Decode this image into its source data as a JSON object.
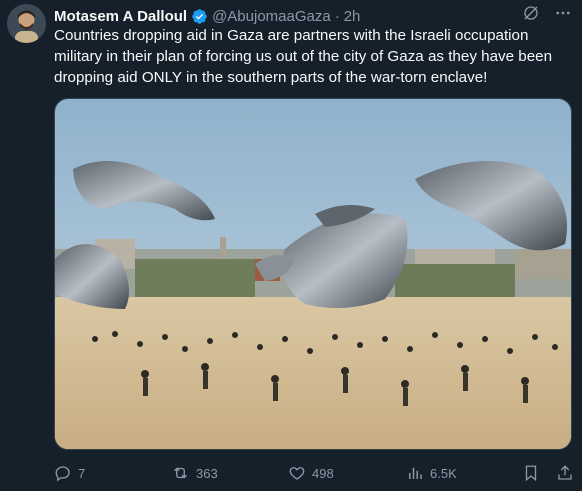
{
  "author": {
    "name": "Motasem A Dalloul",
    "handle": "@AbujomaaGaza",
    "separator": "·",
    "time": "2h"
  },
  "tweet": {
    "text": "Countries dropping aid in Gaza are partners with the Israeli occupation military in their plan of forcing us out of the city of Gaza as they have been dropping aid ONLY in the southern parts of the war-torn enclave!"
  },
  "metrics": {
    "replies": "7",
    "reposts": "363",
    "likes": "498",
    "views": "6.5K"
  },
  "colors": {
    "background": "#15202b",
    "text": "#f7f9f9",
    "muted": "#8b98a5",
    "verified": "#1d9bf0"
  },
  "icons": [
    "verified-badge-icon",
    "grok-icon",
    "more-icon",
    "reply-icon",
    "repost-icon",
    "like-icon",
    "views-icon",
    "bookmark-icon",
    "share-icon"
  ]
}
